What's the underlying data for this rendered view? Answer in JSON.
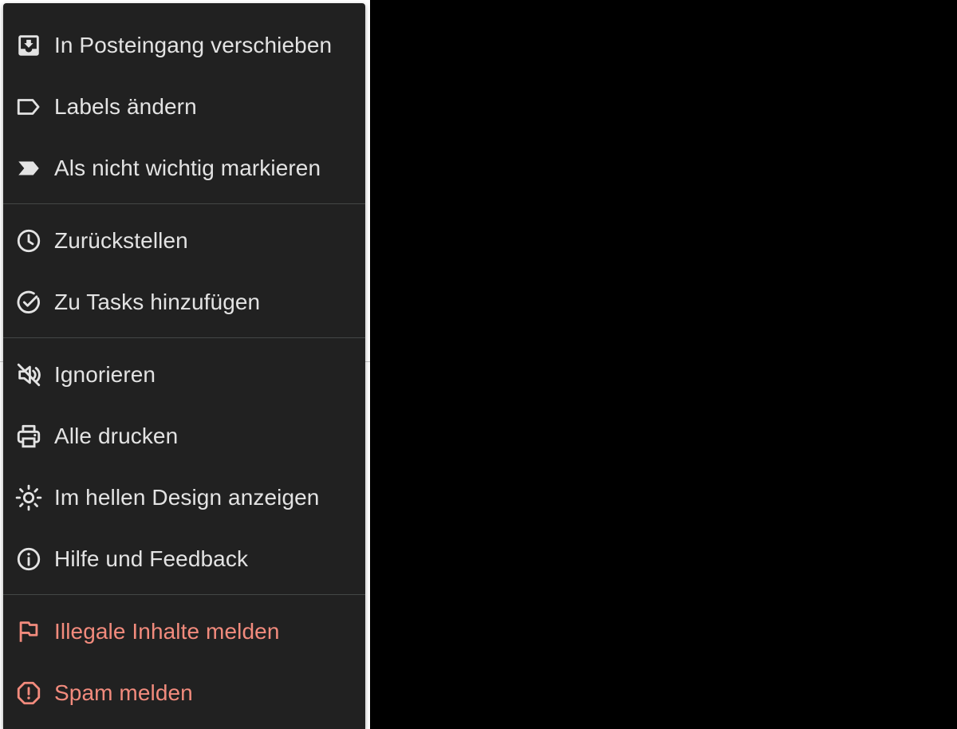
{
  "menu": {
    "items": [
      {
        "label": "In Posteingang verschieben",
        "icon": "move-to-inbox-icon"
      },
      {
        "label": "Labels ändern",
        "icon": "label-outline-icon"
      },
      {
        "label": "Als nicht wichtig markieren",
        "icon": "importance-marker-icon"
      },
      {
        "label": "Zurückstellen",
        "icon": "clock-icon"
      },
      {
        "label": "Zu Tasks hinzufügen",
        "icon": "add-task-icon"
      },
      {
        "label": "Ignorieren",
        "icon": "mute-icon"
      },
      {
        "label": "Alle drucken",
        "icon": "printer-icon"
      },
      {
        "label": "Im hellen Design anzeigen",
        "icon": "sun-icon"
      },
      {
        "label": "Hilfe und Feedback",
        "icon": "info-icon"
      },
      {
        "label": "Illegale Inhalte melden",
        "icon": "flag-icon"
      },
      {
        "label": "Spam melden",
        "icon": "report-spam-icon"
      }
    ]
  },
  "colors": {
    "menu_bg": "#212121",
    "text": "#e3e3e3",
    "danger": "#f28b7d",
    "divider": "#444746",
    "backdrop": "#000000"
  }
}
